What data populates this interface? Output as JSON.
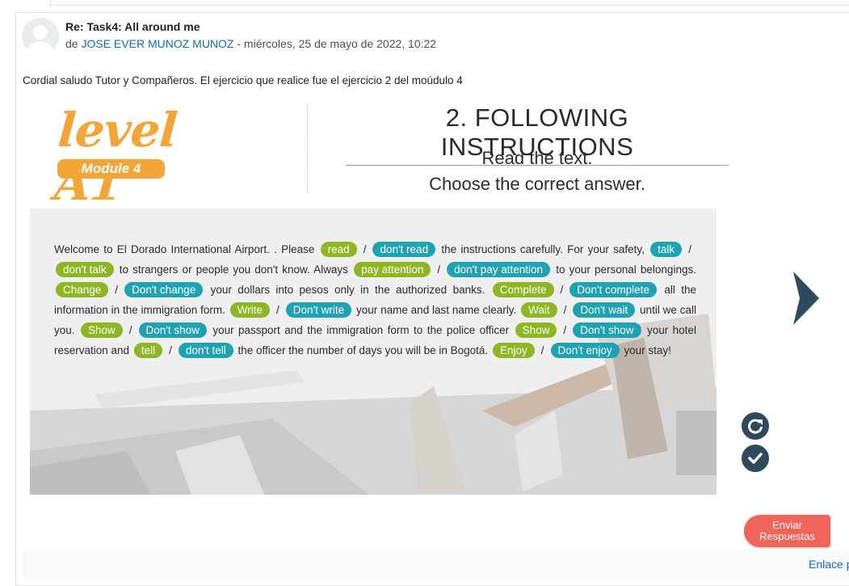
{
  "post": {
    "title": "Re: Task4: All around me",
    "meta_prefix": "de ",
    "author": "JOSE EVER MUNOZ MUNOZ",
    "meta_suffix": " - miércoles, 25 de mayo de 2022, 10:22",
    "body": "Cordial saludo Tutor y Compañeros. El ejercicio que realice fue el ejercicio 2 del moúdulo 4"
  },
  "activity": {
    "logo_text": "level A1",
    "module_label": "Module 4",
    "title": "2. FOLLOWING INSTRUCTIONS",
    "instruction_line1": "Read the text.",
    "instruction_line2": "Choose the correct answer.",
    "text": {
      "t1": "Welcome to El Dorado International Airport. . Please",
      "c1a": "read",
      "c1b": "don't read",
      "t2": "the instructions carefully. For your safety,",
      "c2a": "talk",
      "c2b": "don't talk",
      "t3": "to strangers or people you don't know. Always",
      "c3a": "pay attention",
      "c3b": "don't pay attention",
      "t4": "to your personal belongings.",
      "c4a": "Change",
      "c4b": "Don't change",
      "t5": "your dollars into pesos only in the authorized banks.",
      "c5a": "Complete",
      "c5b": "Don't complete",
      "t6": "all the information in the immigration form.",
      "c6a": "Write",
      "c6b": "Don't write",
      "t7": "your name and last name clearly.",
      "c7a": "Wait",
      "c7b": "Don't wait",
      "t8": "until we call you.",
      "c8a": "Show",
      "c8b": "Don't show",
      "t9": "your passport and the immigration form to the police officer",
      "c9a": "Show",
      "c9b": "Don't show",
      "t10": "your hotel reservation and",
      "c10a": "tell",
      "c10b": "don't tell",
      "t11": "the officer the number of days you will be in Bogotá.",
      "c11a": "Enjoy",
      "c11b": "Don't enjoy",
      "t12": "your stay!",
      "slash": "/"
    },
    "icons": {
      "next": "chevron-right-icon",
      "retry": "refresh-icon",
      "check": "check-icon"
    },
    "submit_label": "Enviar Respuestas"
  },
  "footer": {
    "link": "Enlace p"
  },
  "colors": {
    "accent_link": "#0f6cbf",
    "logo_orange": "#f4a537",
    "chip_green": "#8db622",
    "chip_teal": "#1fa2b1",
    "nav_dark": "#2e4a5c",
    "submit_red": "#f0645a"
  }
}
